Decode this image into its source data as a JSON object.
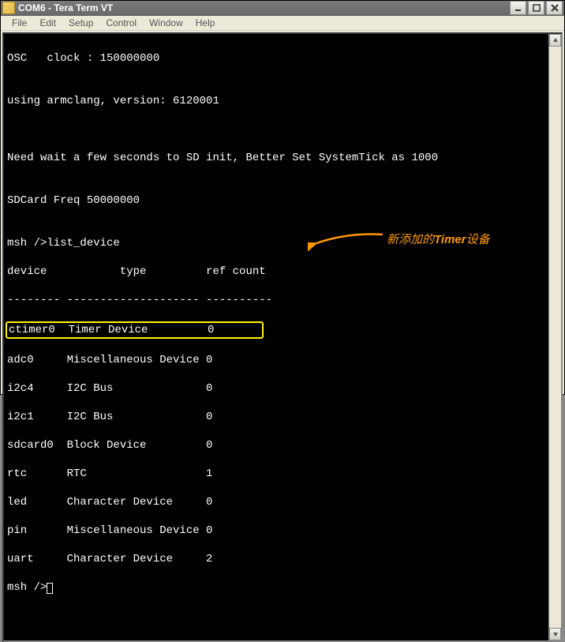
{
  "window": {
    "title": "COM6 - Tera Term VT"
  },
  "menu": {
    "file": "File",
    "edit": "Edit",
    "setup": "Setup",
    "control": "Control",
    "window": "Window",
    "help": "Help"
  },
  "terminal": {
    "lines": {
      "l0": "OSC   clock : 150000000",
      "l1": "",
      "l2": "using armclang, version: 6120001",
      "l3": "",
      "l4": "",
      "l5": "Need wait a few seconds to SD init, Better Set SystemTick as 1000",
      "l6": "",
      "l7": "SDCard Freq 50000000",
      "l8": "",
      "l9": "msh />list_device",
      "hdr": "device           type         ref count",
      "sep": "-------- -------------------- ----------",
      "r0": "ctimer0  Timer Device         0       ",
      "r1": "adc0     Miscellaneous Device 0       ",
      "r2": "i2c4     I2C Bus              0       ",
      "r3": "i2c1     I2C Bus              0       ",
      "r4": "sdcard0  Block Device         0       ",
      "r5": "rtc      RTC                  1       ",
      "r6": "led      Character Device     0       ",
      "r7": "pin      Miscellaneous Device 0       ",
      "r8": "uart     Character Device     2       ",
      "prompt": "msh />"
    }
  },
  "devices": [
    {
      "name": "ctimer0",
      "type": "Timer Device",
      "ref": 0,
      "highlighted": true
    },
    {
      "name": "adc0",
      "type": "Miscellaneous Device",
      "ref": 0,
      "highlighted": false
    },
    {
      "name": "i2c4",
      "type": "I2C Bus",
      "ref": 0,
      "highlighted": false
    },
    {
      "name": "i2c1",
      "type": "I2C Bus",
      "ref": 0,
      "highlighted": false
    },
    {
      "name": "sdcard0",
      "type": "Block Device",
      "ref": 0,
      "highlighted": false
    },
    {
      "name": "rtc",
      "type": "RTC",
      "ref": 1,
      "highlighted": false
    },
    {
      "name": "led",
      "type": "Character Device",
      "ref": 0,
      "highlighted": false
    },
    {
      "name": "pin",
      "type": "Miscellaneous Device",
      "ref": 0,
      "highlighted": false
    },
    {
      "name": "uart",
      "type": "Character Device",
      "ref": 2,
      "highlighted": false
    }
  ],
  "annotation": {
    "prefix": "新添加的",
    "bold": "Timer",
    "suffix": "设备",
    "color": "#ff9900",
    "highlight_color": "#fff200"
  }
}
